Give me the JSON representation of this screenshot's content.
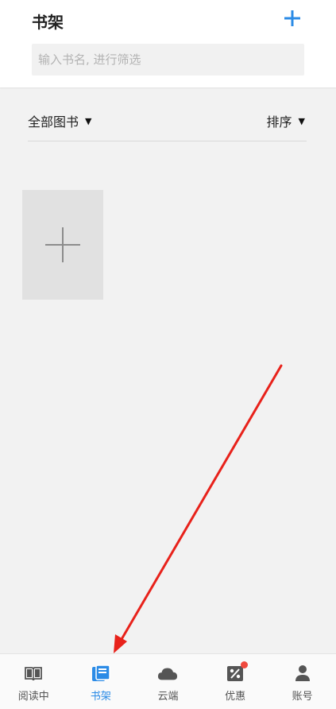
{
  "header": {
    "title": "书架",
    "search_placeholder": "输入书名, 进行筛选",
    "search_value": ""
  },
  "filter": {
    "category": "全部图书",
    "sort": "排序"
  },
  "tabs": [
    {
      "label": "阅读中",
      "icon": "book-open-icon",
      "active": false
    },
    {
      "label": "书架",
      "icon": "bookshelf-icon",
      "active": true
    },
    {
      "label": "云端",
      "icon": "cloud-icon",
      "active": false
    },
    {
      "label": "优惠",
      "icon": "discount-icon",
      "active": false,
      "badge": true
    },
    {
      "label": "账号",
      "icon": "account-icon",
      "active": false
    }
  ],
  "colors": {
    "accent": "#2b8be6",
    "annotation_arrow": "#e8221b",
    "badge": "#f0493e"
  }
}
